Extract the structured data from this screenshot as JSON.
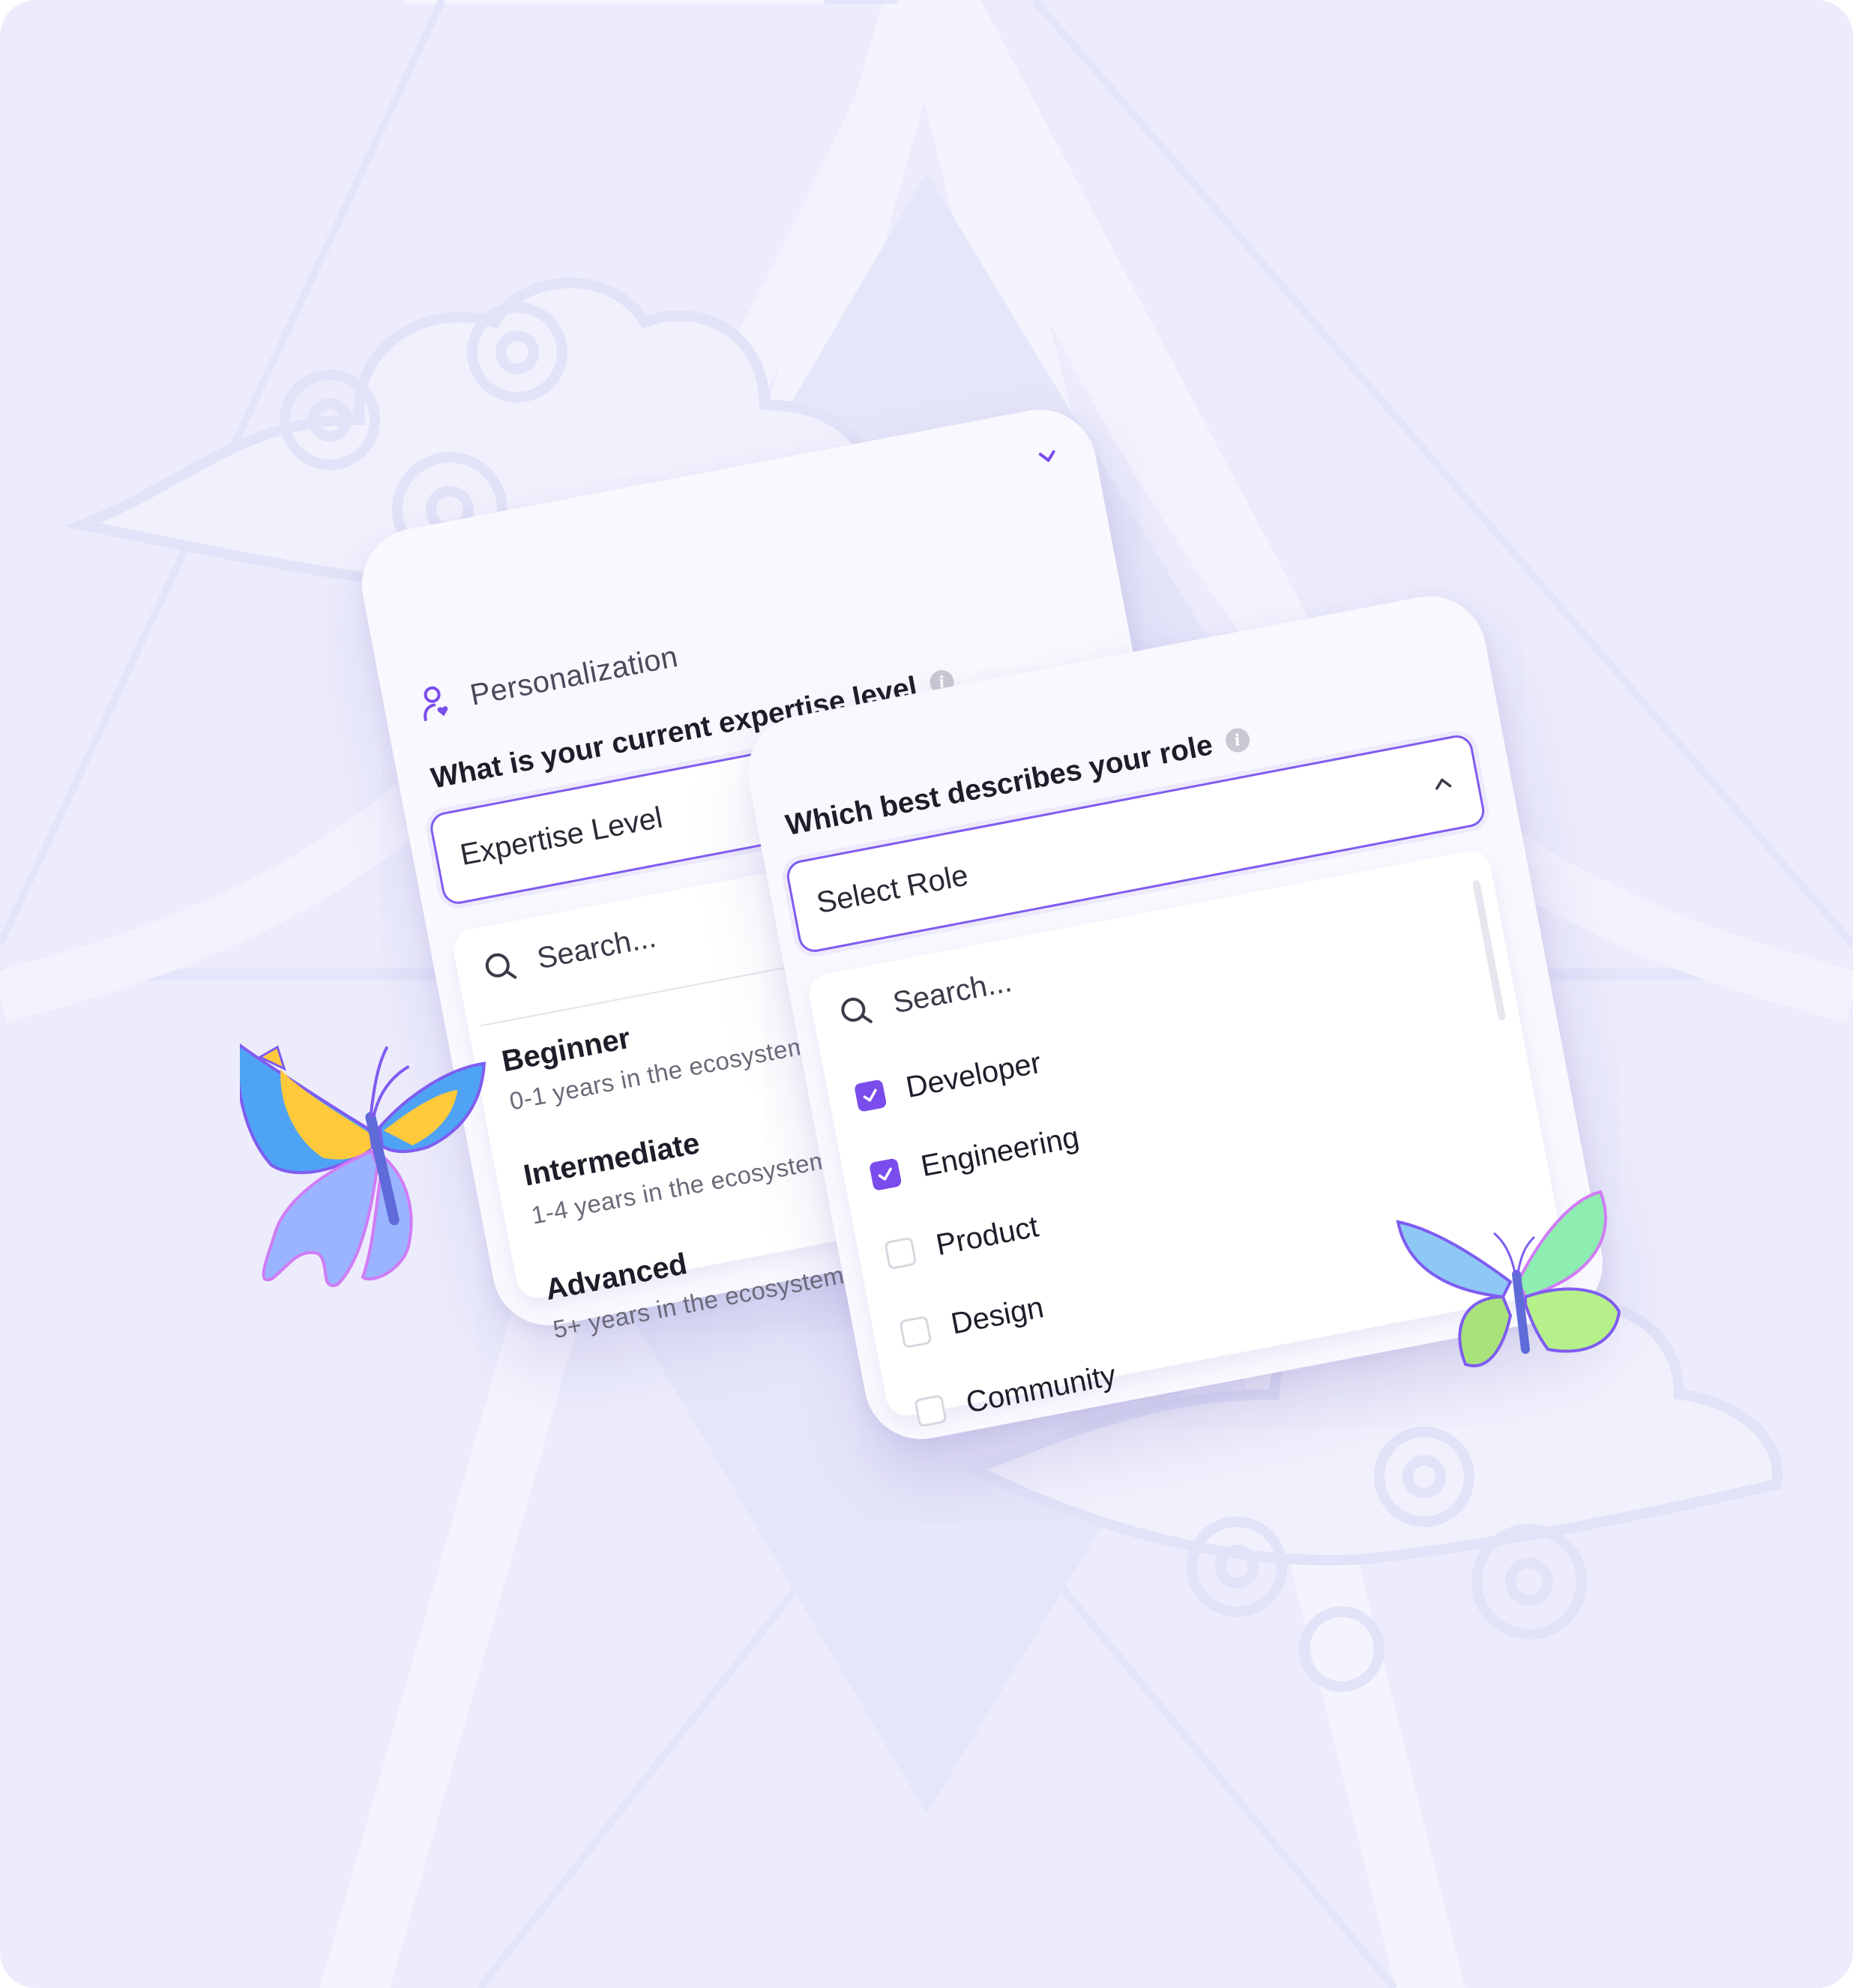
{
  "expertise_card": {
    "section_title": "Personalization",
    "question": "What is your current expertise level",
    "select_placeholder": "Expertise Level",
    "search_placeholder": "Search...",
    "options": [
      {
        "title": "Beginner",
        "subtitle": "0-1 years in the ecosystem"
      },
      {
        "title": "Intermediate",
        "subtitle": "1-4 years in the ecosystem"
      },
      {
        "title": "Advanced",
        "subtitle": "5+ years in the ecosystem"
      }
    ]
  },
  "role_card": {
    "question": "Which best describes your role",
    "select_placeholder": "Select Role",
    "search_placeholder": "Search...",
    "options": [
      {
        "label": "Developer",
        "checked": true
      },
      {
        "label": "Engineering",
        "checked": true
      },
      {
        "label": "Product",
        "checked": false
      },
      {
        "label": "Design",
        "checked": false
      },
      {
        "label": "Community",
        "checked": false
      }
    ]
  },
  "icons": {
    "info": "i"
  },
  "colors": {
    "background": "#ECECFC",
    "accent": "#7F5CF0",
    "checkbox_checked": "#7A4CEB",
    "card": "#F8F8FE"
  }
}
